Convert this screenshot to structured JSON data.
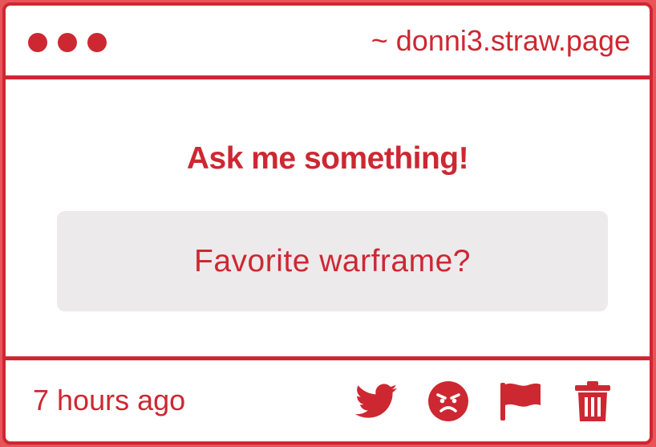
{
  "window": {
    "url": "~ donni3.straw.page",
    "controls": [
      "close",
      "minimize",
      "maximize"
    ]
  },
  "main": {
    "heading": "Ask me something!",
    "question": "Favorite warframe?"
  },
  "footer": {
    "timestamp": "7 hours ago",
    "actions": [
      {
        "icon": "twitter-icon",
        "name": "share-twitter-button"
      },
      {
        "icon": "angry-face-icon",
        "name": "react-angry-button"
      },
      {
        "icon": "flag-icon",
        "name": "report-button"
      },
      {
        "icon": "trash-icon",
        "name": "delete-button"
      }
    ]
  },
  "colors": {
    "accent": "#cd2832",
    "background": "#ffffff",
    "question_bg": "#eceaeb",
    "outer": "#e9545a"
  }
}
